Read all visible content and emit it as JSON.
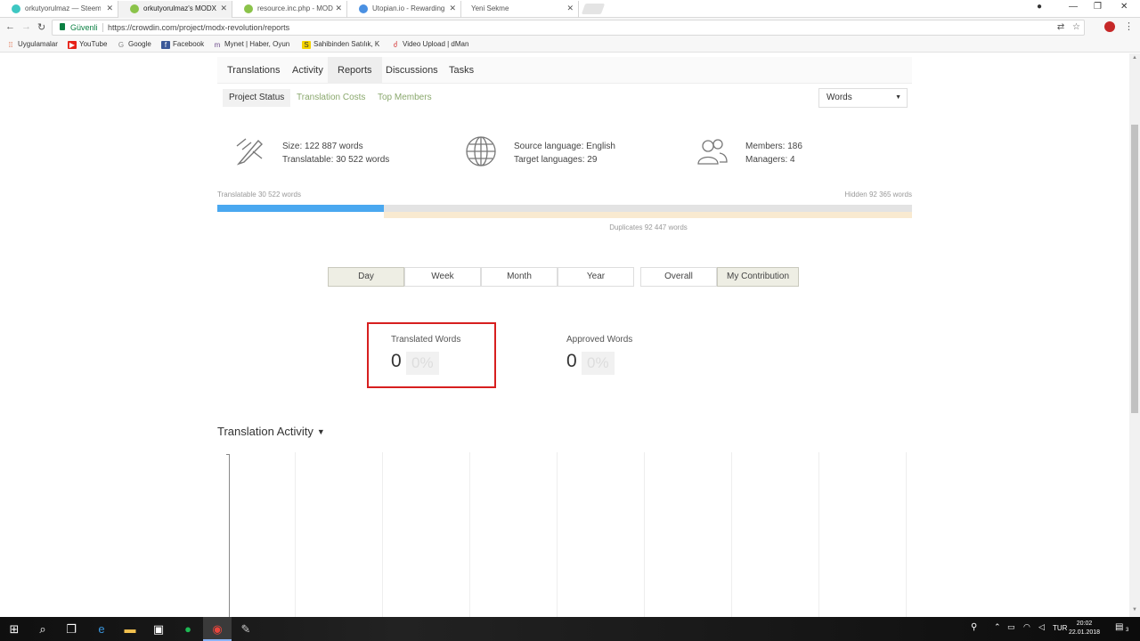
{
  "browser": {
    "tabs": [
      {
        "label": "orkutyorulmaz — Steem",
        "favicon_color": "#3ec7c2",
        "active": false
      },
      {
        "label": "orkutyorulmaz's MODX",
        "favicon_color": "#8bc34a",
        "active": true
      },
      {
        "label": "resource.inc.php - MODX",
        "favicon_color": "#8bc34a",
        "active": false
      },
      {
        "label": "Utopian.io - Rewarding",
        "favicon_color": "#4a90e2",
        "active": false
      },
      {
        "label": "Yeni Sekme",
        "favicon_color": "",
        "active": false
      }
    ],
    "secure_label": "Güvenli",
    "url": "https://crowdin.com/project/modx-revolution/reports",
    "bookmarks": [
      {
        "label": "Uygulamalar",
        "icon": "apps-grid-icon",
        "color": "#d84315"
      },
      {
        "label": "YouTube",
        "icon": "youtube-icon",
        "color": "#e62117"
      },
      {
        "label": "Google",
        "icon": "google-icon",
        "color": "#888888"
      },
      {
        "label": "Facebook",
        "icon": "facebook-icon",
        "color": "#3b5998"
      },
      {
        "label": "Mynet | Haber, Oyun",
        "icon": "mynet-icon",
        "color": "#6d4c8c"
      },
      {
        "label": "Sahibinden Satılık, K",
        "icon": "sahibinden-icon",
        "color": "#f5d300"
      },
      {
        "label": "Video Upload | dMan",
        "icon": "dmania-icon",
        "color": "#d32f2f"
      }
    ]
  },
  "project_nav": {
    "items": [
      "Translations",
      "Activity",
      "Reports",
      "Discussions",
      "Tasks"
    ],
    "active": "Reports"
  },
  "report_tabs": {
    "items": [
      "Project Status",
      "Translation Costs",
      "Top Members"
    ],
    "active": "Project Status"
  },
  "unit_select": {
    "value": "Words"
  },
  "stats": {
    "size": "Size: 122 887 words",
    "translatable": "Translatable: 30 522 words",
    "source_language": "Source language: English",
    "target_languages": "Target languages: 29",
    "members": "Members: 186",
    "managers": "Managers: 4"
  },
  "progress": {
    "translatable_label": "Translatable 30 522 words",
    "hidden_label": "Hidden 92 365 words",
    "duplicates_label": "Duplicates 92 447 words",
    "translatable_fraction": 0.24,
    "colors": {
      "translatable": "#4aa8f0",
      "hidden": "#e3e3e3",
      "duplicates": "#f9ead0"
    }
  },
  "period_buttons": {
    "items": [
      "Day",
      "Week",
      "Month",
      "Year"
    ],
    "active": "Day"
  },
  "scope_buttons": {
    "items": [
      "Overall",
      "My Contribution"
    ],
    "active": "My Contribution"
  },
  "metrics": {
    "translated": {
      "title": "Translated Words",
      "value": "0",
      "percent": "0%"
    },
    "approved": {
      "title": "Approved Words",
      "value": "0",
      "percent": "0%"
    }
  },
  "activity": {
    "title": "Translation Activity"
  },
  "taskbar": {
    "language": "TUR",
    "time": "20:02",
    "date": "22.01.2018",
    "notification_count": "3"
  }
}
